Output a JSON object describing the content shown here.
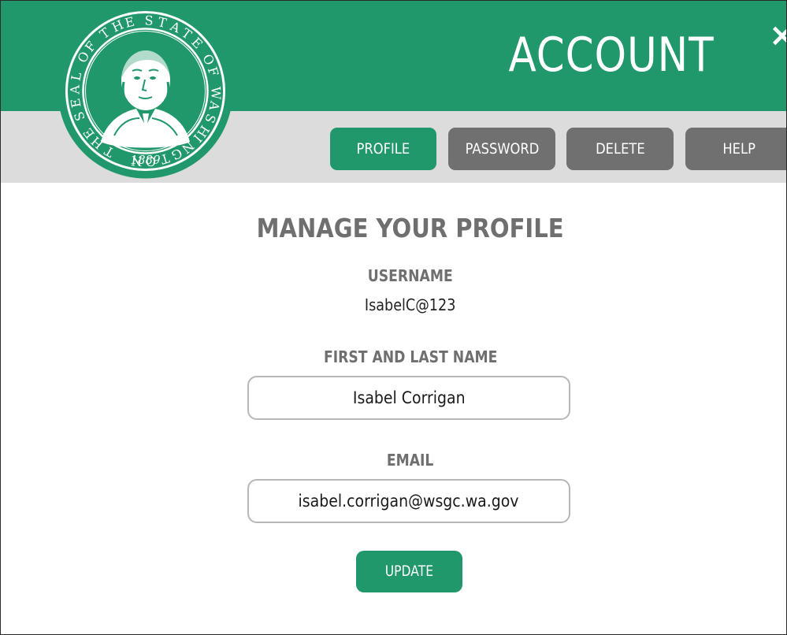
{
  "header": {
    "title": "ACCOUNT",
    "close_glyph": "×",
    "close_icon": "close-icon",
    "seal": {
      "top_text": "THE SEAL OF THE STATE OF WASHINGTON",
      "year": "1889",
      "icon": "state-seal-portrait-icon"
    }
  },
  "tabs": [
    {
      "label": "PROFILE",
      "active": true
    },
    {
      "label": "PASSWORD",
      "active": false
    },
    {
      "label": "DELETE",
      "active": false
    },
    {
      "label": "HELP",
      "active": false
    }
  ],
  "main": {
    "title": "MANAGE YOUR PROFILE",
    "username": {
      "label": "USERNAME",
      "value": "IsabelC@123"
    },
    "name": {
      "label": "FIRST AND LAST NAME",
      "value": "Isabel Corrigan"
    },
    "email": {
      "label": "EMAIL",
      "value": "isabel.corrigan@wsgc.wa.gov"
    },
    "update_label": "UPDATE"
  },
  "colors": {
    "brand_green": "#21986b",
    "tab_inactive": "#707070",
    "band_gray": "#dcdcdc",
    "label_gray": "#6f6f6f"
  }
}
